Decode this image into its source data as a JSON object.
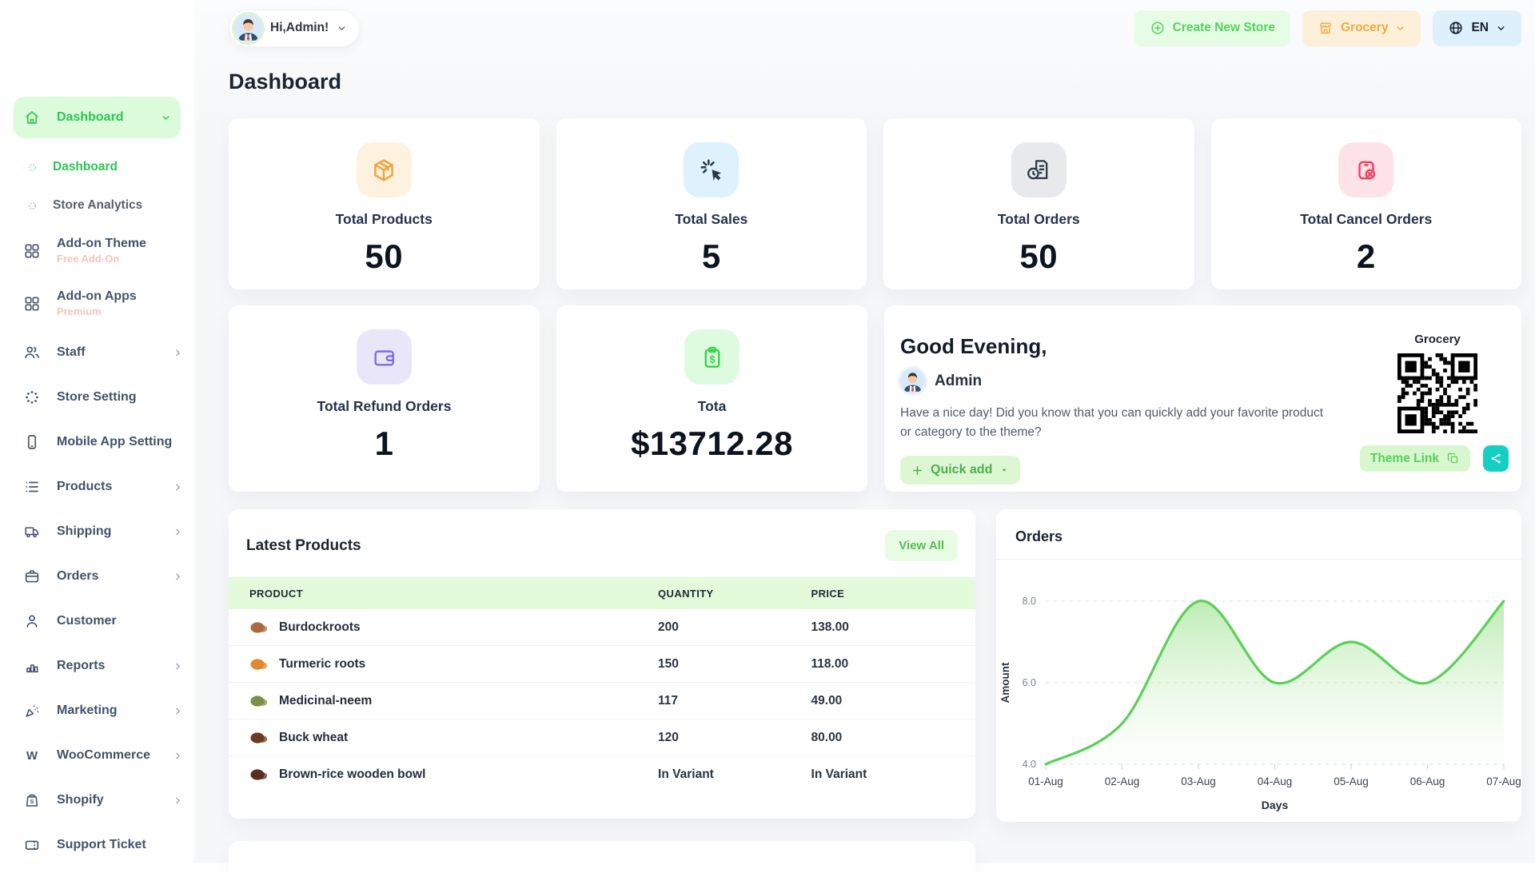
{
  "page_title": "Dashboard",
  "topbar": {
    "greeting": "Hi,Admin!",
    "create_store_label": "Create New Store",
    "store_switcher_label": "Grocery",
    "language_label": "EN"
  },
  "sidebar": {
    "items": [
      {
        "id": "dashboard",
        "label": "Dashboard",
        "icon": "home-icon",
        "type": "parent",
        "active": true,
        "chevron": "down",
        "children": [
          {
            "id": "dashboard-sub",
            "label": "Dashboard",
            "active": true
          },
          {
            "id": "store-analytics",
            "label": "Store Analytics",
            "active": false
          }
        ]
      },
      {
        "id": "addon-theme",
        "label": "Add-on Theme",
        "icon": "grid-icon",
        "badge": "Free Add-On"
      },
      {
        "id": "addon-apps",
        "label": "Add-on Apps",
        "icon": "grid-icon",
        "badge": "Premium"
      },
      {
        "id": "staff",
        "label": "Staff",
        "icon": "users-icon",
        "chevron": "right"
      },
      {
        "id": "store-setting",
        "label": "Store Setting",
        "icon": "loader-icon"
      },
      {
        "id": "mobile-app-setting",
        "label": "Mobile App Setting",
        "icon": "smartphone-icon"
      },
      {
        "id": "products",
        "label": "Products",
        "icon": "list-icon",
        "chevron": "right"
      },
      {
        "id": "shipping",
        "label": "Shipping",
        "icon": "truck-icon",
        "chevron": "right"
      },
      {
        "id": "orders",
        "label": "Orders",
        "icon": "briefcase-icon",
        "chevron": "right"
      },
      {
        "id": "customer",
        "label": "Customer",
        "icon": "user-icon"
      },
      {
        "id": "reports",
        "label": "Reports",
        "icon": "bar-chart-icon",
        "chevron": "right"
      },
      {
        "id": "marketing",
        "label": "Marketing",
        "icon": "megaphone-icon",
        "chevron": "right"
      },
      {
        "id": "woocommerce",
        "label": "WooCommerce",
        "icon": "woocommerce-icon",
        "chevron": "right"
      },
      {
        "id": "shopify",
        "label": "Shopify",
        "icon": "shopify-bag-icon",
        "chevron": "right"
      },
      {
        "id": "support-ticket",
        "label": "Support Ticket",
        "icon": "ticket-icon"
      }
    ]
  },
  "stats": [
    {
      "label": "Total Products",
      "value": "50",
      "icon": "package-box-icon",
      "icon_color": "#f2a33a",
      "icon_bg": "#fdf2df"
    },
    {
      "label": "Total Sales",
      "value": "5",
      "icon": "cursor-click-icon",
      "icon_color": "#2c3848",
      "icon_bg": "#def2fd"
    },
    {
      "label": "Total Orders",
      "value": "50",
      "icon": "order-document-icon",
      "icon_color": "#2c3848",
      "icon_bg": "#e7e9eb"
    },
    {
      "label": "Total Cancel Orders",
      "value": "2",
      "icon": "cancel-box-icon",
      "icon_color": "#f43f5e",
      "icon_bg": "#fde3e8"
    },
    {
      "label": "Total Refund Orders",
      "value": "1",
      "icon": "wallet-icon",
      "icon_color": "#7e6be8",
      "icon_bg": "#eae6f9"
    },
    {
      "label": "Tota",
      "value": "$13712.28",
      "icon": "money-clipboard-icon",
      "icon_color": "#35d54a",
      "icon_bg": "#defbe0"
    }
  ],
  "greeting_card": {
    "title": "Good Evening,",
    "user_name": "Admin",
    "message": "Have a nice day! Did you know that you can quickly add your favorite product or category to the theme?",
    "quick_add_label": "Quick add",
    "qr_title": "Grocery",
    "theme_link_label": "Theme Link"
  },
  "latest_products": {
    "title": "Latest Products",
    "view_all_label": "View All",
    "columns": [
      "PRODUCT",
      "QUANTITY",
      "PRICE"
    ],
    "rows": [
      {
        "name": "Burdockroots",
        "quantity": "200",
        "price": "138.00",
        "thumb_color": "#a96a3e"
      },
      {
        "name": "Turmeric roots",
        "quantity": "150",
        "price": "118.00",
        "thumb_color": "#e2882f"
      },
      {
        "name": "Medicinal-neem",
        "quantity": "117",
        "price": "49.00",
        "thumb_color": "#7b8f45"
      },
      {
        "name": "Buck wheat",
        "quantity": "120",
        "price": "80.00",
        "thumb_color": "#6d3b23"
      },
      {
        "name": "Brown-rice wooden bowl",
        "quantity": "In Variant",
        "price": "In Variant",
        "thumb_color": "#5c2e22"
      }
    ]
  },
  "chart_data": {
    "type": "area",
    "title": "Orders",
    "x": [
      "01-Aug",
      "02-Aug",
      "03-Aug",
      "04-Aug",
      "05-Aug",
      "06-Aug",
      "07-Aug"
    ],
    "series": [
      {
        "name": "Orders",
        "values": [
          4,
          5,
          8,
          6,
          7,
          6,
          8
        ]
      }
    ],
    "xlabel": "Days",
    "ylabel": "Amount",
    "ylim": [
      4,
      8
    ],
    "yticks": [
      "4.0",
      "6.0",
      "8.0"
    ],
    "grid": "dashed-horizontal",
    "legend": "none",
    "line_color": "#5bd058"
  }
}
